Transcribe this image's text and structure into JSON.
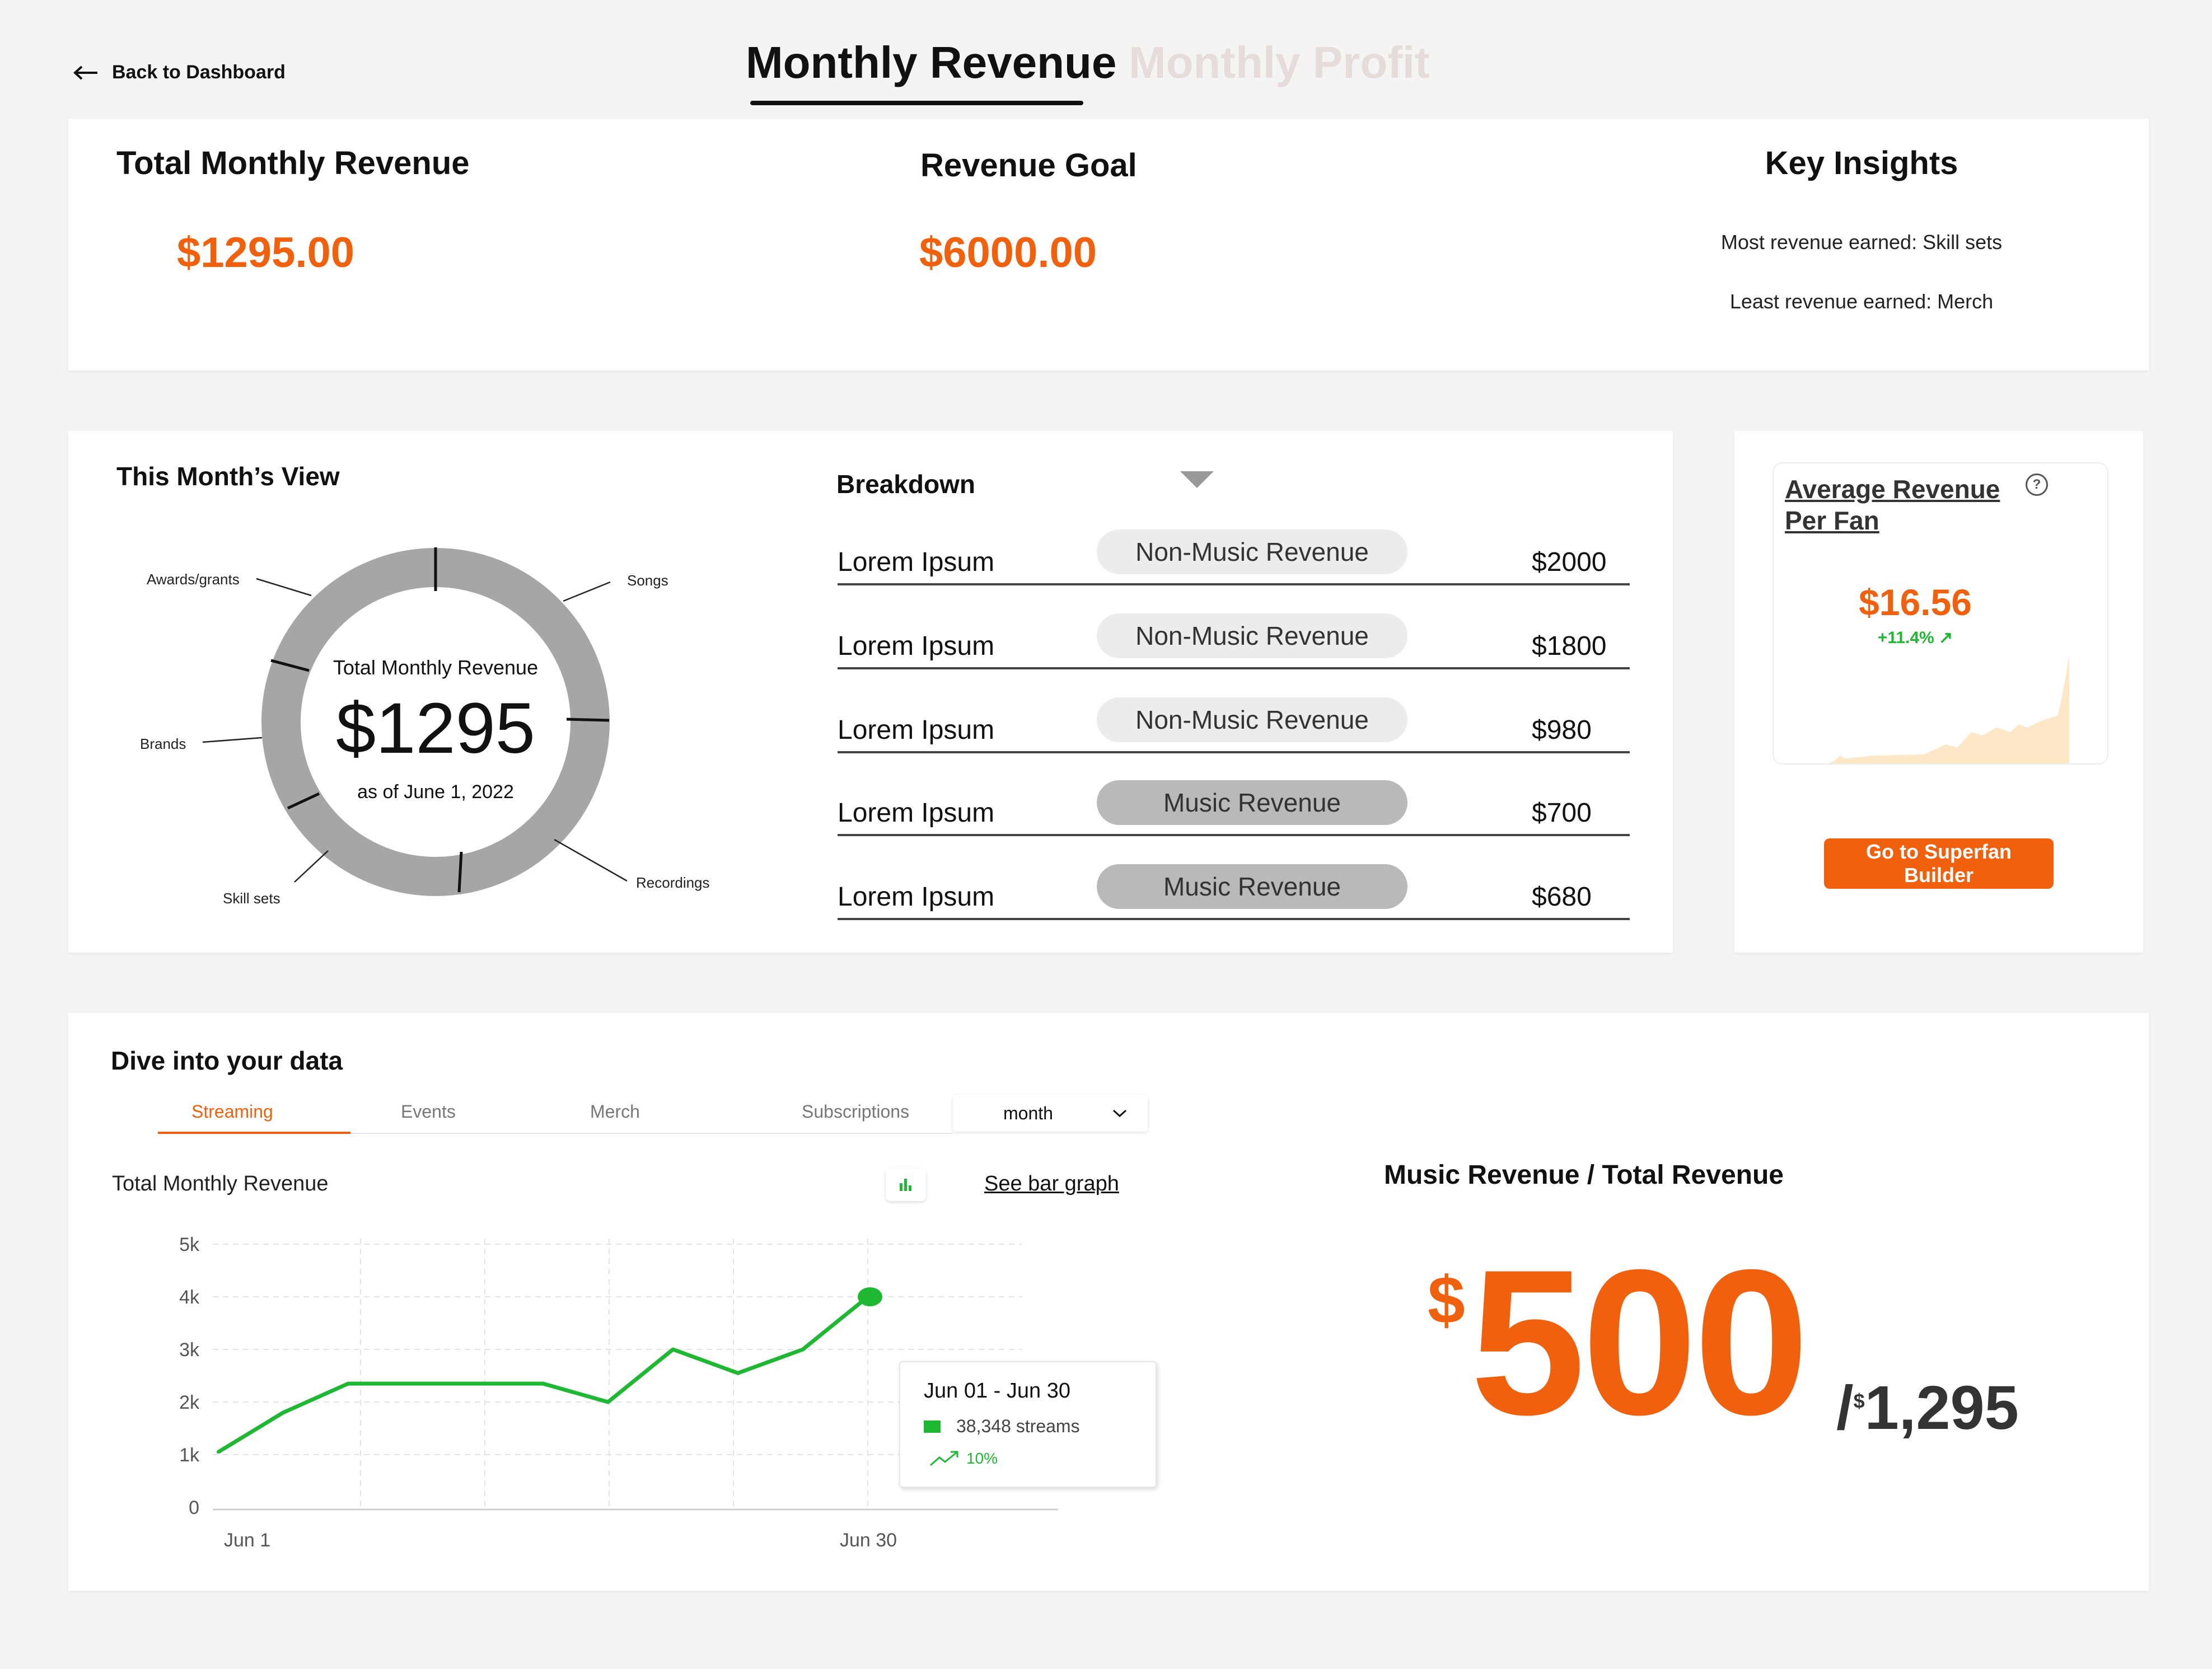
{
  "header": {
    "back_label": "Back to Dashboard",
    "tabs": [
      {
        "label": "Monthly Revenue",
        "active": true
      },
      {
        "label": "Monthly Profit",
        "active": false
      }
    ]
  },
  "summary": {
    "total": {
      "title": "Total Monthly Revenue",
      "value": "$1295.00"
    },
    "goal": {
      "title": "Revenue Goal",
      "value": "$6000.00"
    },
    "insights": {
      "title": "Key Insights",
      "most": "Most revenue earned: Skill sets",
      "least": "Least revenue earned: Merch"
    }
  },
  "month_view": {
    "title": "This Month’s View",
    "center_label": "Total Monthly Revenue",
    "center_value": "$1295",
    "center_date": "as of June 1, 2022",
    "segments": [
      "Awards/grants",
      "Songs",
      "Brands",
      "Recordings",
      "Skill sets"
    ]
  },
  "breakdown": {
    "title": "Breakdown",
    "rows": [
      {
        "name": "Lorem Ipsum",
        "category": "Non-Music Revenue",
        "amount": "$2000"
      },
      {
        "name": "Lorem Ipsum",
        "category": "Non-Music Revenue",
        "amount": "$1800"
      },
      {
        "name": "Lorem Ipsum",
        "category": "Non-Music Revenue",
        "amount": "$980"
      },
      {
        "name": "Lorem Ipsum",
        "category": "Music Revenue",
        "amount": "$700"
      },
      {
        "name": "Lorem Ipsum",
        "category": "Music Revenue",
        "amount": "$680"
      }
    ]
  },
  "avg_fan": {
    "title_line1": "Average Revenue",
    "title_line2": "Per Fan",
    "value": "$16.56",
    "change": "+11.4% ↗",
    "cta_line1": "Go to Superfan",
    "cta_line2": "Builder"
  },
  "dive": {
    "title": "Dive into your data",
    "tabs": [
      "Streaming",
      "Events",
      "Merch",
      "Subscriptions"
    ],
    "active_tab": "Streaming",
    "period": "month",
    "chart_title": "Total Monthly Revenue",
    "see_bar_label": "See bar graph",
    "tooltip": {
      "title": "Jun 01 - Jun 30",
      "streams": "38,348 streams",
      "pct": "10%"
    }
  },
  "ratio": {
    "title": "Music Revenue / Total Revenue",
    "currency": "$",
    "value": "500",
    "total_prefix": "/",
    "total_currency": "$",
    "total": "1,295"
  },
  "colors": {
    "accent": "#f0600d",
    "green": "#1fb832",
    "donut": "#a6a6a6",
    "area": "#fde7c7"
  },
  "chart_data": {
    "type": "line",
    "x_labels": [
      "Jun 1",
      "Jun 30"
    ],
    "y_ticks": [
      "0",
      "1k",
      "2k",
      "3k",
      "4k",
      "5k"
    ],
    "ylim": [
      0,
      5000
    ],
    "x": [
      0,
      1,
      2,
      3,
      4,
      5,
      6,
      7,
      8,
      9,
      10
    ],
    "values": [
      1050,
      1800,
      2350,
      2350,
      2350,
      2350,
      2000,
      3000,
      2550,
      3000,
      4000
    ],
    "highlight_index": 10,
    "grid": true
  }
}
